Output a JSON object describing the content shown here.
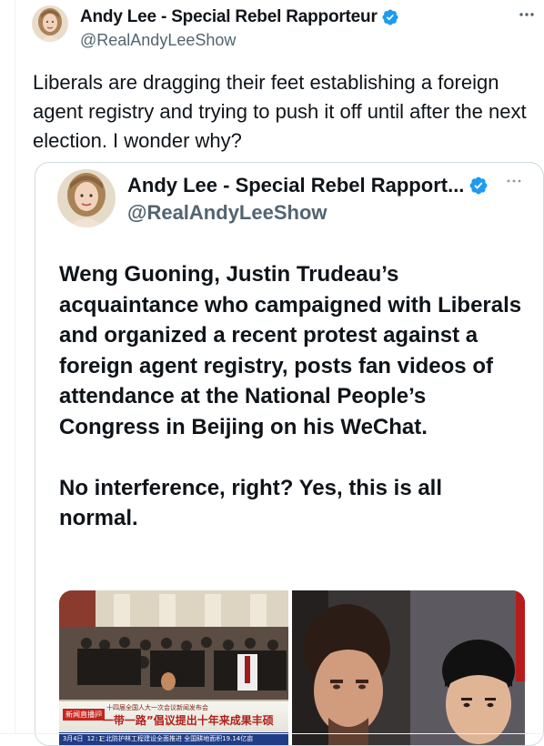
{
  "tweet": {
    "author_name": "Andy Lee - Special Rebel Rapporteur",
    "author_handle": "@RealAndyLeeShow",
    "more_icon": "ellipsis-icon",
    "verified_icon": "verified-badge-icon",
    "text": "Liberals are dragging their feet establishing a foreign agent registry and trying to push it off until after the next election. I wonder why?"
  },
  "quoted_tweet": {
    "author_name": "Andy Lee - Special Rebel Rapport...",
    "author_handle": "@RealAndyLeeShow",
    "paragraphs": [
      "Weng Guoning, Justin Trudeau’s acquaintance who campaigned with Liberals and organized a recent protest against a foreign agent registry, posts fan videos of attendance at the National People’s Congress in Beijing on his WeChat.",
      "No interference, right? Yes, this is all normal."
    ],
    "media": {
      "left_caption_top": "十四届全国人大一次会议新闻发布会",
      "left_caption_main": "“一带一路”倡议提出十年来成果丰硕",
      "left_news_tag": "新闻直播间",
      "left_ticker_date": "3月4日 12:1",
      "left_ticker_text": "三北防护林工程建设全面推进 全国耕地面积19.14亿亩"
    }
  },
  "colors": {
    "text_primary": "#0f1419",
    "text_secondary": "#536471",
    "verified_blue": "#1d9bf0",
    "border": "#cfd9de"
  }
}
